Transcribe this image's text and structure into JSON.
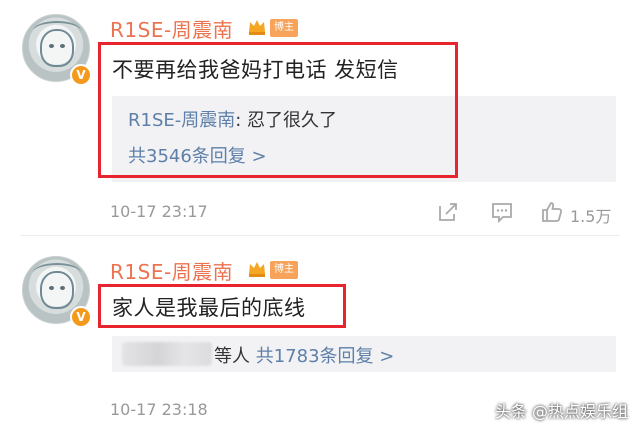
{
  "comments": [
    {
      "username": "R1SE-周震南",
      "host_badge": "博主",
      "text": "不要再给我爸妈打电话 发短信",
      "reply_name": "R1SE-周震南",
      "reply_text": ": 忍了很久了",
      "reply_more": "共3546条回复 >",
      "time": "10-17 23:17",
      "like_count": "1.5万"
    },
    {
      "username": "R1SE-周震南",
      "host_badge": "博主",
      "text": "家人是我最后的底线",
      "reply_prefix": "等人",
      "reply_more": "共1783条回复 >",
      "time": "10-17 23:18"
    }
  ],
  "watermark": "头条 @热点娱乐组",
  "colors": {
    "username": "#eb7350",
    "link": "#5d7fa8",
    "highlight": "#e8242e",
    "badge": "#f39a1d"
  },
  "icons": [
    "share-icon",
    "comment-icon",
    "like-icon",
    "verified-icon",
    "crown-icon"
  ]
}
